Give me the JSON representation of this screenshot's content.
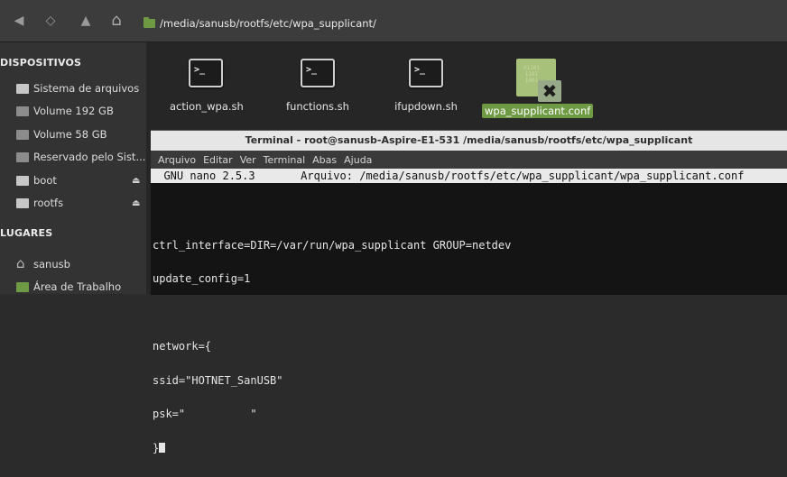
{
  "toolbar": {
    "back": "◀",
    "forward": "◇",
    "up": "▲",
    "home": "⌂",
    "path": "/media/sanusb/rootfs/etc/wpa_supplicant/"
  },
  "sidebar": {
    "devices_heading": "DISPOSITIVOS",
    "devices": [
      {
        "label": "Sistema de arquivos",
        "icon": "drive-icon"
      },
      {
        "label": "Volume 192 GB",
        "icon": "drive-icon"
      },
      {
        "label": "Volume 58 GB",
        "icon": "drive-icon"
      },
      {
        "label": "Reservado pelo Sist...",
        "icon": "drive-icon"
      },
      {
        "label": "boot",
        "icon": "drive-icon"
      },
      {
        "label": "rootfs",
        "icon": "drive-icon"
      }
    ],
    "places_heading": "LUGARES",
    "places": [
      {
        "label": "sanusb",
        "icon": "home-icon"
      },
      {
        "label": "Área de Trabalho",
        "icon": "desktop-icon"
      }
    ]
  },
  "files": [
    {
      "name": "action_wpa.sh",
      "icon": "terminal-script-icon",
      "glyph": ">_"
    },
    {
      "name": "functions.sh",
      "icon": "terminal-script-icon",
      "glyph": ">_"
    },
    {
      "name": "ifupdown.sh",
      "icon": "terminal-script-icon",
      "glyph": ">_"
    },
    {
      "name": "wpa_supplicant.conf",
      "icon": "config-file-icon",
      "bits": "01101\n1101\n1001",
      "badge": "✖"
    }
  ],
  "terminal": {
    "title": "Terminal - root@sanusb-Aspire-E1-531 /media/sanusb/rootfs/etc/wpa_supplicant",
    "menu": [
      "Arquivo",
      "Editar",
      "Ver",
      "Terminal",
      "Abas",
      "Ajuda"
    ],
    "nano_header": "  GNU nano 2.5.3       Arquivo: /media/sanusb/rootfs/etc/wpa_supplicant/wpa_supplicant.conf",
    "lines": [
      "",
      "ctrl_interface=DIR=/var/run/wpa_supplicant GROUP=netdev",
      "update_config=1",
      "",
      "network={",
      "ssid=\"HOTNET_SanUSB\"",
      "psk=\"          \"",
      "}"
    ]
  },
  "colors": {
    "accent": "#6f9a44"
  }
}
